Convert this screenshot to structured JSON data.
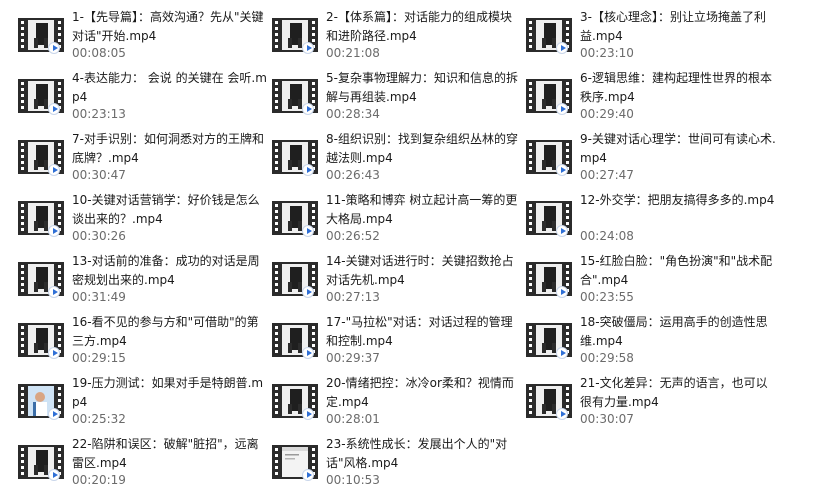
{
  "files": [
    {
      "name": "1-【先导篇】：高效沟通？先从\"关键对话\"开始.mp4",
      "duration": "00:08:05",
      "thumb": "dark"
    },
    {
      "name": "2-【体系篇】：对话能力的组成模块和进阶路径.mp4",
      "duration": "00:21:08",
      "thumb": "dark"
    },
    {
      "name": "3-【核心理念】：别让立场掩盖了利益.mp4",
      "duration": "00:23:10",
      "thumb": "dark"
    },
    {
      "name": "4-表达能力：  会说 的关键在 会听.mp4",
      "duration": "00:23:13",
      "thumb": "dark"
    },
    {
      "name": "5-复杂事物理解力：知识和信息的拆解与再组装.mp4",
      "duration": "00:28:34",
      "thumb": "dark"
    },
    {
      "name": "6-逻辑思维：建构起理性世界的根本秩序.mp4",
      "duration": "00:29:40",
      "thumb": "dark"
    },
    {
      "name": "7-对手识别：如何洞悉对方的王牌和底牌？.mp4",
      "duration": "00:30:47",
      "thumb": "dark"
    },
    {
      "name": "8-组织识别：找到复杂组织丛林的穿越法则.mp4",
      "duration": "00:26:43",
      "thumb": "dark"
    },
    {
      "name": "9-关键对话心理学：世间可有读心术.mp4",
      "duration": "00:27:47",
      "thumb": "dark"
    },
    {
      "name": "10-关键对话营销学：好价钱是怎么谈出来的？.mp4",
      "duration": "00:30:26",
      "thumb": "dark"
    },
    {
      "name": "11-策略和博弈  树立起计高一筹的更大格局.mp4",
      "duration": "00:26:52",
      "thumb": "dark"
    },
    {
      "name": "12-外交学：把朋友搞得多多的.mp4",
      "duration": "00:24:08",
      "thumb": "dark"
    },
    {
      "name": "13-对话前的准备：成功的对话是周密规划出来的.mp4",
      "duration": "00:31:49",
      "thumb": "dark"
    },
    {
      "name": "14-关键对话进行时：关键招数抢占对话先机.mp4",
      "duration": "00:27:13",
      "thumb": "dark"
    },
    {
      "name": "15-红脸白脸：\"角色扮演\"和\"战术配合\".mp4",
      "duration": "00:23:55",
      "thumb": "dark"
    },
    {
      "name": "16-看不见的参与方和\"可借助\"的第三方.mp4",
      "duration": "00:29:15",
      "thumb": "dark"
    },
    {
      "name": "17-\"马拉松\"对话：对话过程的管理和控制.mp4",
      "duration": "00:29:37",
      "thumb": "dark"
    },
    {
      "name": "18-突破僵局：运用高手的创造性思维.mp4",
      "duration": "00:29:58",
      "thumb": "dark"
    },
    {
      "name": "19-压力测试：如果对手是特朗普.mp4",
      "duration": "00:25:32",
      "thumb": "person"
    },
    {
      "name": "20-情绪把控：冰冷or柔和？视情而定.mp4",
      "duration": "00:28:01",
      "thumb": "dark"
    },
    {
      "name": "21-文化差异：无声的语言，也可以很有力量.mp4",
      "duration": "00:30:07",
      "thumb": "dark"
    },
    {
      "name": "22-陷阱和误区：破解\"脏招\"，远离雷区.mp4",
      "duration": "00:20:19",
      "thumb": "dark"
    },
    {
      "name": "23-系统性成长：发展出个人的\"对话\"风格.mp4",
      "duration": "00:10:53",
      "thumb": "window"
    }
  ],
  "colors": {
    "filmstrip": "#2b2b2b",
    "play_accent": "#2f6fd6",
    "duration_text": "#6b6b6b"
  }
}
